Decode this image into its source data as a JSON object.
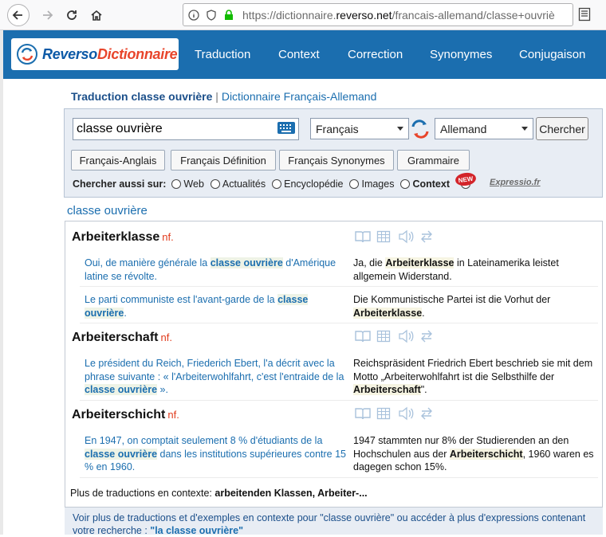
{
  "browser": {
    "url_prefix": "https://dictionnaire.",
    "url_host": "reverso.net",
    "url_path": "/francais-allemand/classe+ouvriè"
  },
  "header": {
    "logo_part1": "Reverso",
    "logo_part2": "Dictionnaire",
    "nav": [
      "Traduction",
      "Context",
      "Correction",
      "Synonymes",
      "Conjugaison"
    ]
  },
  "heading": {
    "title": "Traduction classe ouvrière",
    "separator": " | ",
    "subtitle": "Dictionnaire Français-Allemand"
  },
  "search": {
    "query": "classe ouvrière",
    "source_lang": "Français",
    "target_lang": "Allemand",
    "submit_label": "Chercher",
    "quick_buttons": [
      "Français-Anglais",
      "Français Définition",
      "Français Synonymes",
      "Grammaire"
    ],
    "also_label": "Chercher aussi sur:",
    "also_options": [
      "Web",
      "Actualités",
      "Encyclopédie",
      "Images",
      "Context"
    ],
    "new_badge": "NEW",
    "expressio": "Expressio.fr"
  },
  "results": {
    "heading": "classe ouvrière",
    "entries": [
      {
        "word": "Arbeiterklasse",
        "pos": "nf.",
        "examples": [
          {
            "src": [
              "Oui, de manière générale la ",
              "classe ouvrière",
              " d'Amérique latine se révolte."
            ],
            "tgt": [
              "Ja, die ",
              "Arbeiterklasse",
              " in Lateinamerika leistet allgemein Widerstand."
            ]
          },
          {
            "src": [
              "Le parti communiste est l'avant-garde de la ",
              "classe ouvrière",
              "."
            ],
            "tgt": [
              "Die Kommunistische Partei ist die Vorhut der ",
              "Arbeiterklasse",
              "."
            ]
          }
        ]
      },
      {
        "word": "Arbeiterschaft",
        "pos": "nf.",
        "examples": [
          {
            "src": [
              "Le président du Reich, Friederich Ebert, l'a décrit avec la phrase suivante : « l'Arbeiterwohlfahrt, c'est l'entraide de la ",
              "classe ouvrière",
              " »."
            ],
            "tgt": [
              "Reichspräsident Friedrich Ebert beschrieb sie mit dem Motto „Arbeiterwohlfahrt ist die Selbsthilfe der ",
              "Arbeiterschaft",
              "\"."
            ]
          }
        ]
      },
      {
        "word": "Arbeiterschicht",
        "pos": "nf.",
        "examples": [
          {
            "src": [
              "En 1947, on comptait seulement 8 % d'étudiants de la ",
              "classe ouvrière",
              " dans les institutions supérieures contre 15 % en 1960."
            ],
            "tgt": [
              "1947 stammten nur 8% der Studierenden an den Hochschulen aus der ",
              "Arbeiterschicht",
              ", 1960 waren es dagegen schon 15%."
            ]
          }
        ]
      }
    ],
    "more_label": "Plus de traductions en contexte: ",
    "more_terms": "arbeitenden Klassen, Arbeiter-..."
  },
  "footer_note": {
    "text": "Voir plus de traductions et d'exemples en contexte pour \"classe ouvrière\" ou accéder à plus d'expressions contenant votre recherche : ",
    "link": "\"la classe ouvrière\""
  },
  "colors": {
    "header_blue": "#1b6eaf",
    "logo_red": "#e8452b",
    "pos_red": "#e13b1c",
    "panel_bg": "#e8edf4"
  }
}
